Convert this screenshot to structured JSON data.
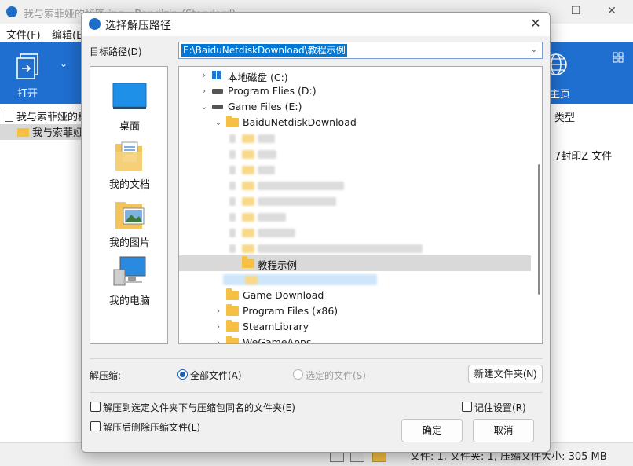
{
  "background": {
    "title": "我与索菲娅的秘密.jpg - Bandizip (Standard)",
    "menu": [
      "文件(F)",
      "编辑(E)"
    ],
    "ribbon_open_label": "打开",
    "ribbon_home_label": "主页",
    "tree_items": [
      "我与索菲娅的秘密.jpg",
      "我与索菲娅的秘密"
    ],
    "col_type_header": "类型",
    "file_type": "7封印Z 文件",
    "status_text": "文件: 1, 文件夹: 1, 压缩文件大小: 305 MB",
    "colors": {
      "ribbon": "#1f6fd1"
    }
  },
  "dialog": {
    "title": "选择解压路径",
    "target_label": "目标路径(D)",
    "target_path": "E:\\BaiduNetdiskDownload\\教程示例",
    "places": [
      {
        "icon": "desktop-icon",
        "label": "桌面"
      },
      {
        "icon": "documents-icon",
        "label": "我的文档"
      },
      {
        "icon": "pictures-icon",
        "label": "我的图片"
      },
      {
        "icon": "computer-icon",
        "label": "我的电脑"
      }
    ],
    "tree": {
      "drive_c": "本地磁盘 (C:)",
      "drive_d": "Program Flies (D:)",
      "drive_e": "Game Files (E:)",
      "baidu_folder": "BaiduNetdiskDownload",
      "selected_folder": "教程示例",
      "game_download": "Game Download",
      "program_files_x86": "Program Files (x86)",
      "steam_library": "SteamLibrary",
      "wegame_apps": "WeGameApps"
    },
    "extract_label": "解压缩:",
    "radio_all": "全部文件(A)",
    "radio_selected": "选定的文件(S)",
    "new_folder_button": "新建文件夹(N)",
    "checkbox_same_name": "解压到选定文件夹下与压缩包同名的文件夹(E)",
    "checkbox_remember": "记住设置(R)",
    "checkbox_delete": "解压后删除压缩文件(L)",
    "ok_button": "确定",
    "cancel_button": "取消",
    "colors": {
      "selection": "#0078d7",
      "folder": "#f6c044"
    }
  }
}
